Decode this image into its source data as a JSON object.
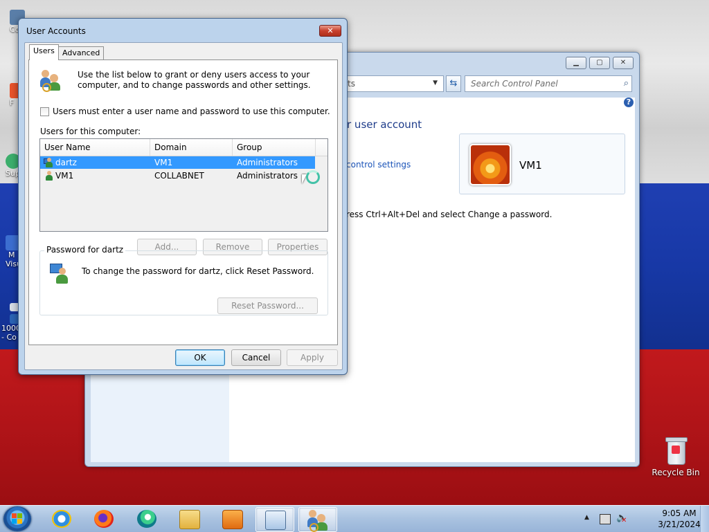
{
  "desktop": {
    "left_icon_fragments": [
      "Co",
      "F",
      "Sup",
      "M",
      "Visu",
      "1000",
      "- Co"
    ],
    "recycle_bin_label": "Recycle Bin"
  },
  "control_panel": {
    "address_fragment": "ts",
    "search_placeholder": "Search Control Panel",
    "heading_fragment": "r user account",
    "link_fragment": "control settings",
    "hint_fragment": "ress Ctrl+Alt+Del and select Change a password.",
    "user_name": "VM1"
  },
  "dialog": {
    "title": "User Accounts",
    "tabs": [
      {
        "label": "Users",
        "selected": true
      },
      {
        "label": "Advanced",
        "selected": false
      }
    ],
    "intro_text": "Use the list below to grant or deny users access to your computer, and to change passwords and other settings.",
    "require_login_label": "Users must enter a user name and password to use this computer.",
    "require_login_checked": false,
    "users_label": "Users for this computer:",
    "columns": [
      "User Name",
      "Domain",
      "Group"
    ],
    "users": [
      {
        "name": "dartz",
        "domain": "VM1",
        "group": "Administrators",
        "selected": true
      },
      {
        "name": "VM1",
        "domain": "COLLABNET",
        "group": "Administrators",
        "selected": false
      }
    ],
    "buttons": {
      "add": "Add...",
      "remove": "Remove",
      "properties": "Properties",
      "reset_password": "Reset Password...",
      "ok": "OK",
      "cancel": "Cancel",
      "apply": "Apply"
    },
    "password_group_label": "Password for dartz",
    "password_text": "To change the password for dartz, click Reset Password."
  },
  "taskbar": {
    "apps": [
      "internet-explorer",
      "firefox",
      "edge",
      "file-explorer",
      "media-player",
      "control-panel",
      "user-accounts"
    ],
    "clock_time": "9:05 AM",
    "clock_date": "3/21/2024"
  },
  "colors": {
    "selection": "#3399ff",
    "wallpaper_blue": "#1738a6",
    "wallpaper_red": "#b01418"
  }
}
